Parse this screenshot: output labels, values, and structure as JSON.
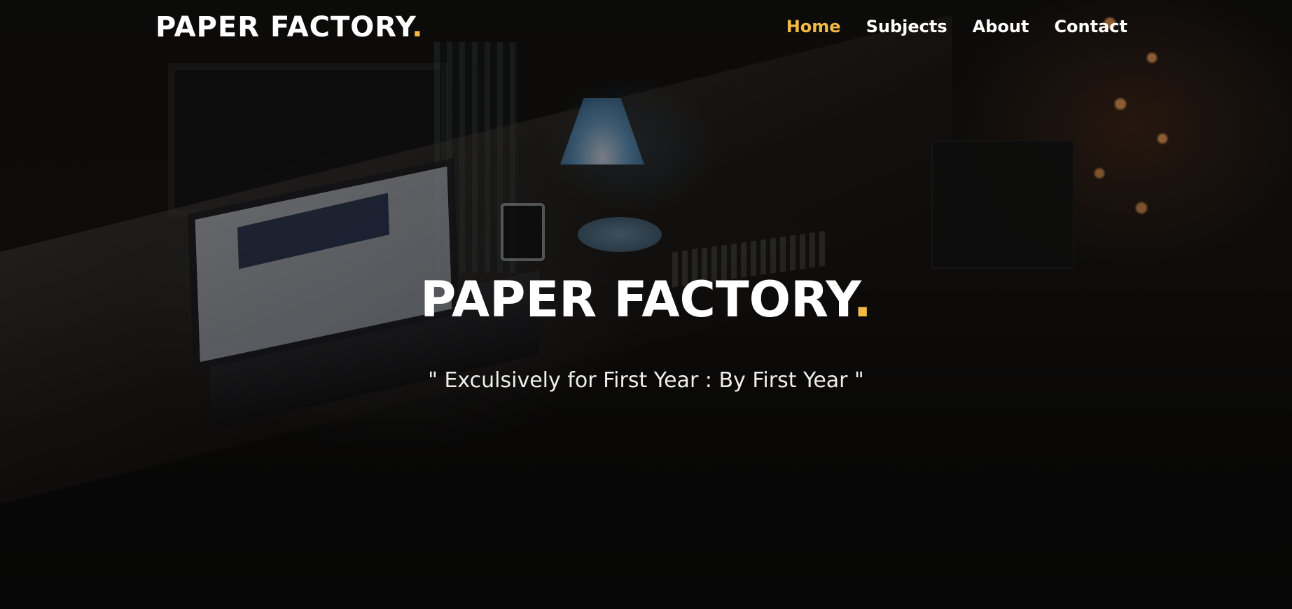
{
  "header": {
    "brand": "PAPER FACTORY",
    "brand_dot": ".",
    "nav": [
      {
        "label": "Home",
        "active": true
      },
      {
        "label": "Subjects",
        "active": false
      },
      {
        "label": "About",
        "active": false
      },
      {
        "label": "Contact",
        "active": false
      }
    ]
  },
  "hero": {
    "title": "PAPER FACTORY",
    "title_dot": ".",
    "subtitle": "\" Exculsively for First Year : By First Year \""
  },
  "colors": {
    "accent": "#f4b942",
    "text": "#ffffff",
    "background": "#0c0b0a"
  }
}
